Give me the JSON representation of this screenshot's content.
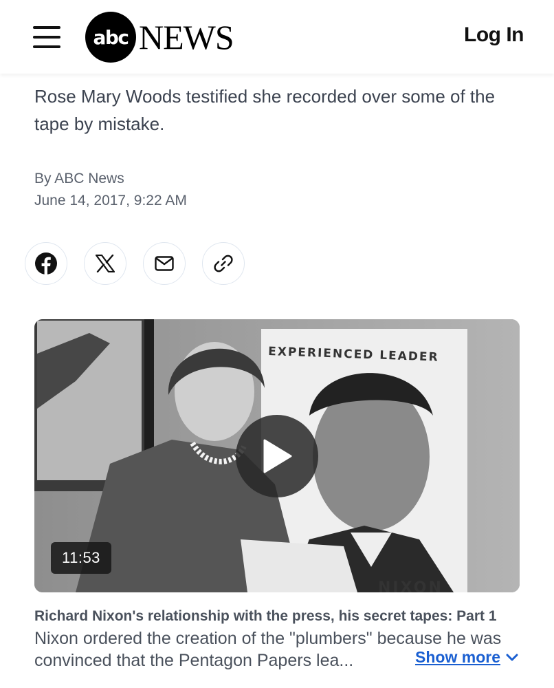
{
  "header": {
    "logo_mark": "abc",
    "logo_word": "NEWS",
    "login_label": "Log In"
  },
  "article": {
    "subhead": "Rose Mary Woods testified she recorded over some of the tape by mistake.",
    "byline": "By ABC News",
    "date": "June 14, 2017, 9:22 AM"
  },
  "share": {
    "buttons": [
      "facebook-icon",
      "x-icon",
      "email-icon",
      "link-icon"
    ]
  },
  "video": {
    "duration": "11:53",
    "poster_sign_text": "EXPERIENCED LEADER",
    "poster_name": "NIXON",
    "caption_title": "Richard Nixon's relationship with the press, his secret tapes: Part 1",
    "caption_body": "Nixon ordered the creation of the \"plumbers\" because he was convinced that the Pentagon Papers lea...",
    "show_more_label": "Show more"
  },
  "colors": {
    "link_blue": "#1a5fd1",
    "text": "#3c4350",
    "share_border": "#dfe6ef"
  }
}
